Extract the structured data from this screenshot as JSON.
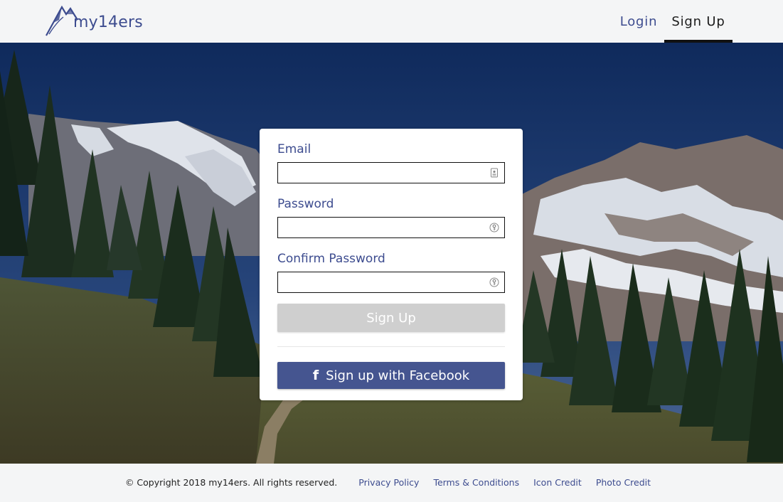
{
  "header": {
    "logo_text": "my14ers",
    "nav": {
      "login": "Login",
      "signup": "Sign Up"
    }
  },
  "form": {
    "email_label": "Email",
    "email_value": "",
    "email_icon": "contact-card-icon",
    "password_label": "Password",
    "password_value": "",
    "password_icon": "key-icon",
    "confirm_label": "Confirm Password",
    "confirm_value": "",
    "confirm_icon": "key-icon",
    "signup_button": "Sign Up",
    "facebook_icon": "f",
    "facebook_button": "Sign up with Facebook"
  },
  "footer": {
    "copyright": "© Copyright 2018 my14ers. All rights reserved.",
    "links": [
      "Privacy Policy",
      "Terms & Conditions",
      "Icon Credit",
      "Photo Credit"
    ]
  },
  "colors": {
    "brand": "#3d4c8f",
    "facebook": "#455590",
    "disabled_button": "#cfcfcf"
  }
}
